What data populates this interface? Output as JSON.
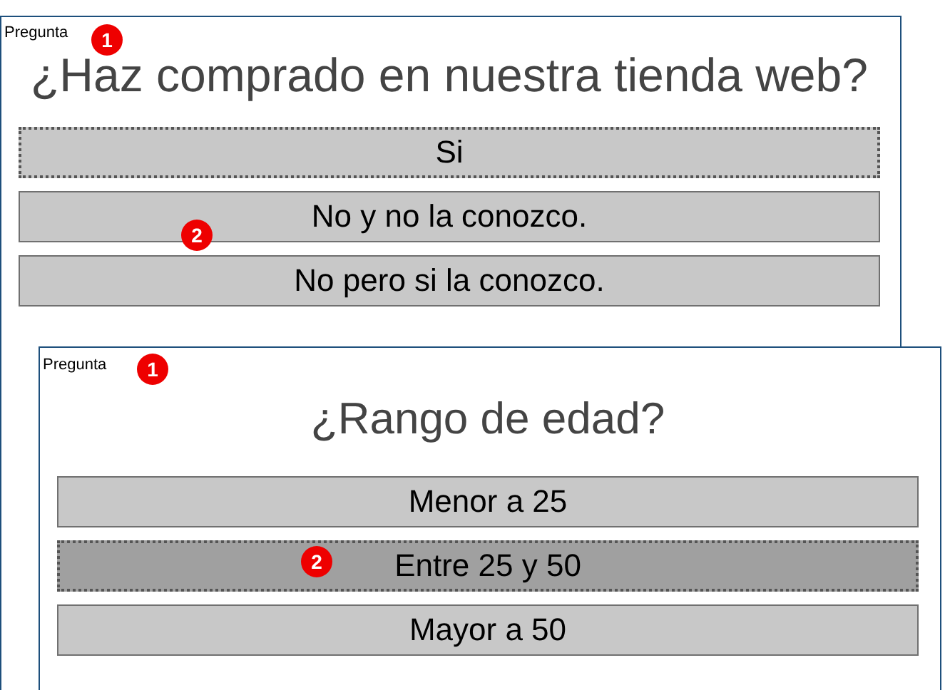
{
  "windows": [
    {
      "label": "Pregunta",
      "question": "¿Haz comprado en nuestra tienda web?",
      "options": [
        {
          "text": "Si",
          "focused": true,
          "selected": false
        },
        {
          "text": "No y no la conozco.",
          "focused": false,
          "selected": false
        },
        {
          "text": "No pero si la conozco.",
          "focused": false,
          "selected": false
        }
      ],
      "markers": [
        "1",
        "2"
      ]
    },
    {
      "label": "Pregunta",
      "question": "¿Rango de edad?",
      "options": [
        {
          "text": "Menor a 25",
          "focused": false,
          "selected": false
        },
        {
          "text": "Entre 25 y 50",
          "focused": true,
          "selected": true
        },
        {
          "text": "Mayor a 50",
          "focused": false,
          "selected": false
        }
      ],
      "markers": [
        "1",
        "2"
      ]
    }
  ]
}
